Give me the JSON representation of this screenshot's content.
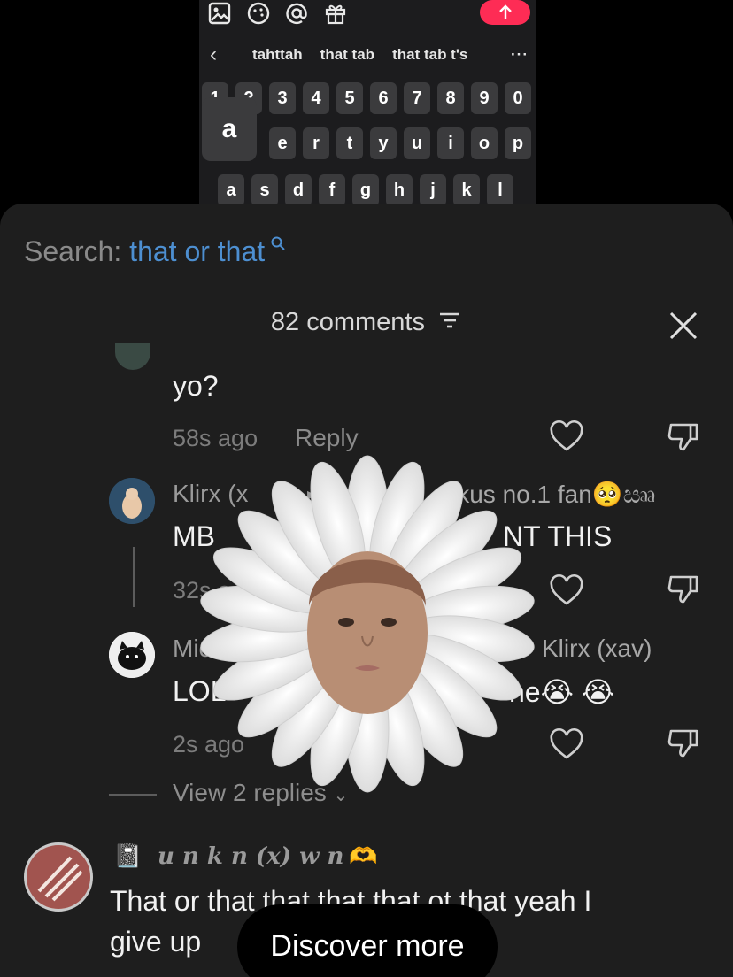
{
  "keyboard": {
    "suggestions": [
      "tahttah",
      "that tab",
      "that tab t's"
    ],
    "more": "···",
    "number_row": [
      "1",
      "2",
      "3",
      "4",
      "5",
      "6",
      "7",
      "8",
      "9",
      "0"
    ],
    "top_row": [
      "e",
      "r",
      "t",
      "y",
      "u",
      "i",
      "o",
      "p"
    ],
    "home_row": [
      "a",
      "s",
      "d",
      "f",
      "g",
      "h",
      "j",
      "k",
      "l"
    ],
    "popup_key": "a",
    "send_color": "#fe2c55"
  },
  "search": {
    "label": "Search: ",
    "query": "that or that"
  },
  "comments_header": {
    "count_label": "82 comments"
  },
  "comments": [
    {
      "text": "yo?",
      "time": "58s ago",
      "reply": "Reply"
    },
    {
      "author": "Klirx (x",
      "reply_to": "ikus no.1 fan🥺ඎ",
      "text": "MB",
      "text_tail": "NT THIS",
      "time": "32s ag"
    },
    {
      "author": "Michi",
      "reply_to": "Klirx (xav)",
      "text": "LOL",
      "text_tail": "he😭 😭",
      "time": "2s ago"
    }
  ],
  "view_replies": "View 2 replies",
  "bottom_comment": {
    "author": "u n k n (x) w n",
    "author_emoji": "🫶",
    "author_prefix_emoji": "📓",
    "text_line1": "That or that that that that ot that yeah I",
    "text_line2": "give up"
  },
  "discover_button": "Discover more",
  "colors": {
    "accent_blue": "#4d8fd1",
    "sheet_bg": "#1e1e1e"
  }
}
